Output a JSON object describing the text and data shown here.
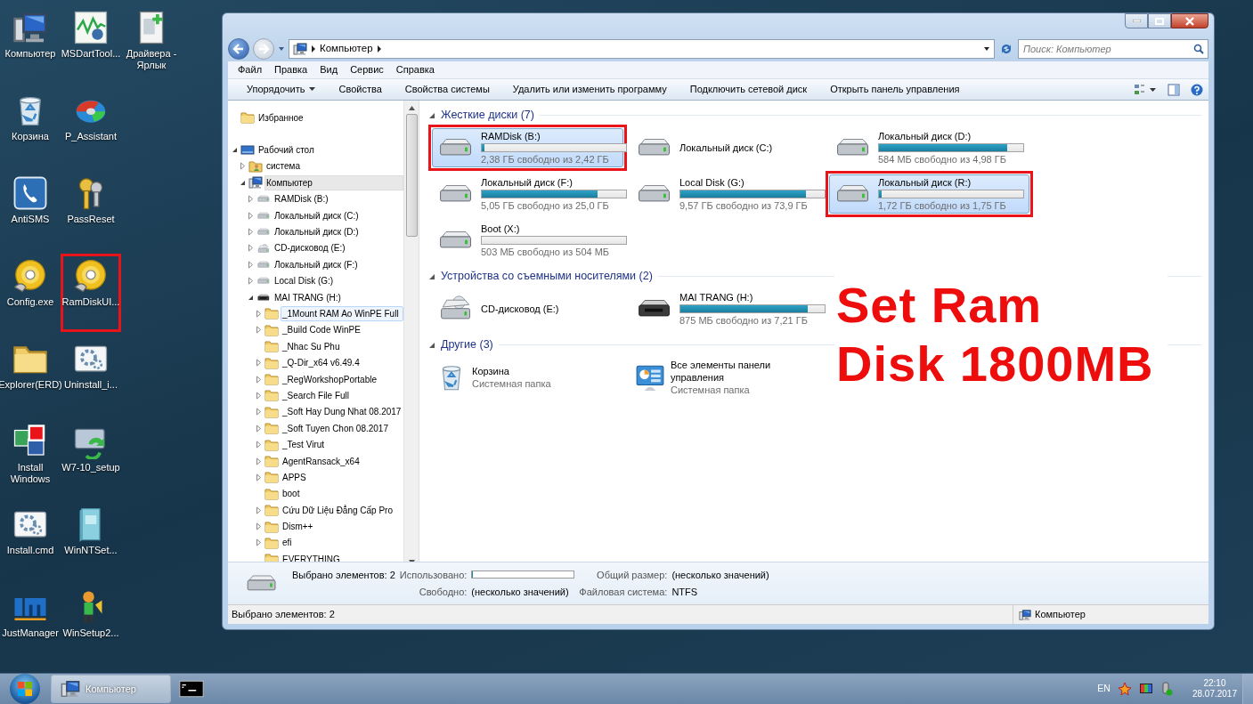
{
  "desktop": {
    "icons": [
      {
        "label": "Компьютер",
        "kind": "computer",
        "highlighted": false
      },
      {
        "label": "Корзина",
        "kind": "recycle",
        "highlighted": false
      },
      {
        "label": "AntiSMS",
        "kind": "phone",
        "highlighted": false
      },
      {
        "label": "Config.exe",
        "kind": "disc",
        "highlighted": false
      },
      {
        "label": "Explorer(ERD)",
        "kind": "folder",
        "highlighted": false
      },
      {
        "label": "Install Windows",
        "kind": "squares",
        "highlighted": false
      },
      {
        "label": "Install.cmd",
        "kind": "gear",
        "highlighted": false
      },
      {
        "label": "JustManager",
        "kind": "blocks",
        "highlighted": false
      },
      {
        "label": "MSDartTool...",
        "kind": "chart",
        "highlighted": false
      },
      {
        "label": "P_Assistant",
        "kind": "ring",
        "highlighted": false
      },
      {
        "label": "PassReset",
        "kind": "key",
        "highlighted": false
      },
      {
        "label": "RamDiskUI...",
        "kind": "disc",
        "highlighted": true
      },
      {
        "label": "Uninstall_i...",
        "kind": "gear",
        "highlighted": false
      },
      {
        "label": "W7-10_setup",
        "kind": "monitor",
        "highlighted": false
      },
      {
        "label": "WinNTSet...",
        "kind": "book",
        "highlighted": false
      },
      {
        "label": "WinSetup2...",
        "kind": "figure",
        "highlighted": false
      },
      {
        "label": "Драйвера - Ярлык",
        "kind": "document",
        "highlighted": false
      }
    ]
  },
  "window": {
    "address": {
      "path": [
        "Компьютер"
      ]
    },
    "search": {
      "placeholder": "Поиск: Компьютер"
    },
    "menu": [
      "Файл",
      "Правка",
      "Вид",
      "Сервис",
      "Справка"
    ],
    "commands": [
      {
        "label": "Упорядочить",
        "dropdown": true
      },
      {
        "label": "Свойства",
        "dropdown": false
      },
      {
        "label": "Свойства системы",
        "dropdown": false
      },
      {
        "label": "Удалить или изменить программу",
        "dropdown": false
      },
      {
        "label": "Подключить сетевой диск",
        "dropdown": false
      },
      {
        "label": "Открыть панель управления",
        "dropdown": false
      }
    ],
    "nav_tree": [
      {
        "label": "Избранное",
        "kind": "folder",
        "selected": false,
        "hovered": false
      },
      {
        "label": "Рабочий стол",
        "kind": "desktop",
        "expanded": true,
        "selected": false,
        "hovered": false,
        "children": [
          {
            "label": "система",
            "kind": "user",
            "expanded": false,
            "selected": false,
            "hovered": false
          },
          {
            "label": "Компьютер",
            "kind": "computer",
            "expanded": true,
            "selected": true,
            "hovered": false,
            "children": [
              {
                "label": "RAMDisk (B:)",
                "kind": "drive",
                "expanded": false,
                "selected": false,
                "hovered": false
              },
              {
                "label": "Локальный диск (C:)",
                "kind": "drive",
                "expanded": false,
                "selected": false,
                "hovered": false
              },
              {
                "label": "Локальный диск (D:)",
                "kind": "drive",
                "expanded": false,
                "selected": false,
                "hovered": false
              },
              {
                "label": "CD-дисковод (E:)",
                "kind": "cd",
                "expanded": false,
                "selected": false,
                "hovered": false
              },
              {
                "label": "Локальный диск (F:)",
                "kind": "drive",
                "expanded": false,
                "selected": false,
                "hovered": false
              },
              {
                "label": "Local Disk (G:)",
                "kind": "drive",
                "expanded": false,
                "selected": false,
                "hovered": false
              },
              {
                "label": "MAI TRANG (H:)",
                "kind": "usb",
                "expanded": true,
                "selected": false,
                "hovered": false,
                "children": [
                  {
                    "label": "_1Mount RAM Ao WinPE Full",
                    "kind": "folder",
                    "expanded": false,
                    "selected": false,
                    "hovered": true
                  },
                  {
                    "label": "_Build Code WinPE",
                    "kind": "folder",
                    "expanded": false,
                    "selected": false,
                    "hovered": false
                  },
                  {
                    "label": "_Nhac Su Phu",
                    "kind": "folder",
                    "selected": false,
                    "hovered": false
                  },
                  {
                    "label": "_Q-Dir_x64 v6.49.4",
                    "kind": "folder",
                    "expanded": false,
                    "selected": false,
                    "hovered": false
                  },
                  {
                    "label": "_RegWorkshopPortable",
                    "kind": "folder",
                    "expanded": false,
                    "selected": false,
                    "hovered": false
                  },
                  {
                    "label": "_Search File Full",
                    "kind": "folder",
                    "expanded": false,
                    "selected": false,
                    "hovered": false
                  },
                  {
                    "label": "_Soft Hay Dung Nhat 08.2017",
                    "kind": "folder",
                    "expanded": false,
                    "selected": false,
                    "hovered": false
                  },
                  {
                    "label": "_Soft Tuyen Chon 08.2017",
                    "kind": "folder",
                    "expanded": false,
                    "selected": false,
                    "hovered": false
                  },
                  {
                    "label": "_Test Virut",
                    "kind": "folder",
                    "expanded": false,
                    "selected": false,
                    "hovered": false
                  },
                  {
                    "label": "AgentRansack_x64",
                    "kind": "folder",
                    "expanded": false,
                    "selected": false,
                    "hovered": false
                  },
                  {
                    "label": "APPS",
                    "kind": "folder",
                    "expanded": false,
                    "selected": false,
                    "hovered": false
                  },
                  {
                    "label": "boot",
                    "kind": "folder",
                    "selected": false,
                    "hovered": false
                  },
                  {
                    "label": "Cứu Dữ Liệu Đẳng Cấp Pro",
                    "kind": "folder",
                    "expanded": false,
                    "selected": false,
                    "hovered": false
                  },
                  {
                    "label": "Dism++",
                    "kind": "folder",
                    "expanded": false,
                    "selected": false,
                    "hovered": false
                  },
                  {
                    "label": "efi",
                    "kind": "folder",
                    "expanded": false,
                    "selected": false,
                    "hovered": false
                  },
                  {
                    "label": "EVERYTHING",
                    "kind": "folder",
                    "selected": false,
                    "hovered": false
                  }
                ]
              }
            ]
          }
        ]
      }
    ],
    "groups": [
      {
        "title": "Жесткие диски",
        "count": "(7)",
        "expanded": true,
        "items": [
          {
            "kind": "drive",
            "name": "RAMDisk (B:)",
            "free": "2,38 ГБ свободно из 2,42 ГБ",
            "level": 0.02,
            "selected": true,
            "highlighted": true
          },
          {
            "kind": "drive",
            "name": "Локальный диск (C:)",
            "selected": false,
            "highlighted": false
          },
          {
            "kind": "drive",
            "name": "Локальный диск (D:)",
            "free": "584 МБ свободно из 4,98 ГБ",
            "level": 0.89,
            "selected": false,
            "highlighted": false
          },
          {
            "kind": "drive",
            "name": "Локальный диск (F:)",
            "free": "5,05 ГБ свободно из 25,0 ГБ",
            "level": 0.8,
            "selected": false,
            "highlighted": false
          },
          {
            "kind": "drive",
            "name": "Local Disk (G:)",
            "free": "9,57 ГБ свободно из 73,9 ГБ",
            "level": 0.87,
            "selected": false,
            "highlighted": false
          },
          {
            "kind": "drive",
            "name": "Локальный диск (R:)",
            "free": "1,72 ГБ свободно из 1,75 ГБ",
            "level": 0.02,
            "selected": true,
            "highlighted": true
          },
          {
            "kind": "drive",
            "name": "Boot (X:)",
            "free": "503 МБ свободно из 504 МБ",
            "level": 0.003,
            "selected": false,
            "highlighted": false
          }
        ]
      },
      {
        "title": "Устройства со съемными носителями",
        "count": "(2)",
        "expanded": true,
        "items": [
          {
            "kind": "cd",
            "name": "CD-дисковод (E:)",
            "selected": false,
            "highlighted": false
          },
          {
            "kind": "usb",
            "name": "MAI TRANG (H:)",
            "free": "875 МБ свободно из 7,21 ГБ",
            "level": 0.88,
            "selected": false,
            "highlighted": false
          }
        ]
      },
      {
        "title": "Другие",
        "count": "(3)",
        "expanded": true,
        "items": [
          {
            "kind": "recycle",
            "name": "Корзина",
            "subtitle": "Системная папка",
            "selected": false,
            "highlighted": false
          },
          {
            "kind": "control",
            "name": "Все элементы панели управления",
            "subtitle": "Системная папка",
            "selected": false,
            "highlighted": false
          }
        ]
      }
    ],
    "details": {
      "summary": "Выбрано элементов: 2",
      "fields": [
        {
          "label": "Использовано:",
          "kind": "bar",
          "level": 0.01
        },
        {
          "label": "Общий размер:",
          "kind": "text",
          "value": "(несколько значений)"
        },
        {
          "label": "Свободно:",
          "kind": "text",
          "value": "(несколько значений)"
        },
        {
          "label": "Файловая система:",
          "kind": "text",
          "value": "NTFS"
        }
      ]
    },
    "status_bar": {
      "text": "Выбрано элементов: 2",
      "location": "Компьютер"
    }
  },
  "annotation": {
    "lines": [
      "Set Ram",
      "Disk 1800MB"
    ]
  },
  "taskbar": {
    "tasks": [
      {
        "label": "Компьютер",
        "kind": "computer",
        "selected": true
      },
      {
        "kind": "console",
        "selected": false
      }
    ],
    "language": "EN",
    "time": "22:10",
    "date": "28.07.2017"
  }
}
